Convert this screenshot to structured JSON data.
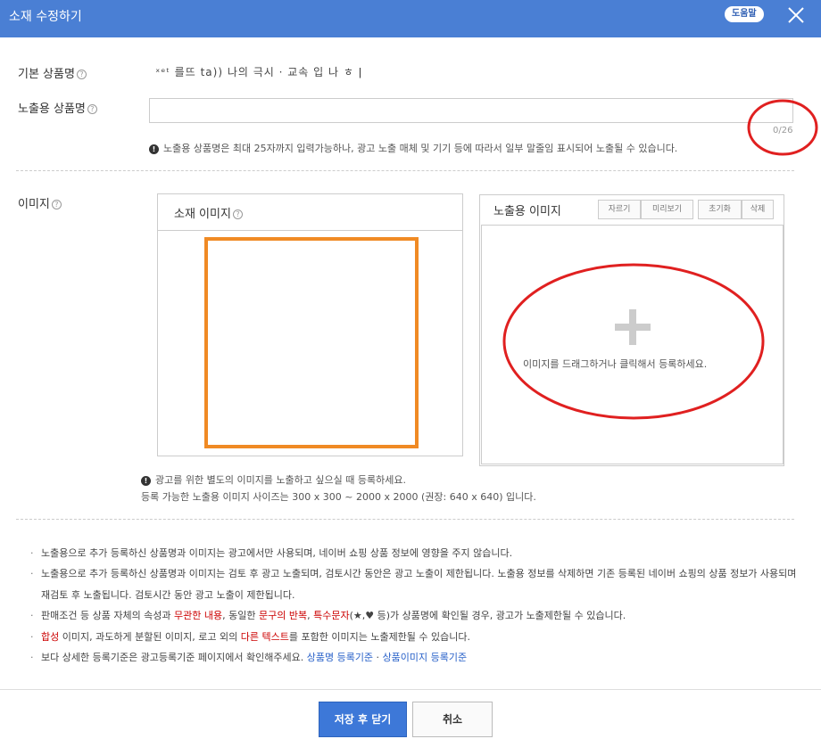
{
  "dialog": {
    "title": "소재 수정하기",
    "help_label": "도움말"
  },
  "form": {
    "basic_name_label": "기본 상품명",
    "basic_name_value": "ˣᵉᵗ 를뜨 ta)) 나의 극시 · 교속 입 나 ㅎ  ǀ",
    "display_name_label": "노출용 상품명",
    "display_name_value": "",
    "display_name_placeholder": "",
    "char_count": "0/26",
    "name_notice": "노출용 상품명은 최대 25자까지 입력가능하나, 광고 노출 매체 및 기기 등에 따라서 일부 말줄임 표시되어 노출될 수 있습니다."
  },
  "image": {
    "section_label": "이미지",
    "source_panel_title": "소재 이미지",
    "display_panel_title": "노출용 이미지",
    "tools": [
      "자르기",
      "미리보기",
      "초기화",
      "삭제"
    ],
    "drop_text": "이미지를 드래그하거나 클릭해서 등록하세요.",
    "notice_line1": "광고를 위한 별도의 이미지를 노출하고 싶으실 때 등록하세요.",
    "notice_line2": "등록 가능한 노출용 이미지 사이즈는 300 x 300 ~ 2000 x 2000 (권장: 640 x 640) 입니다."
  },
  "guidelines": {
    "b1": "노출용으로 추가 등록하신 상품명과 이미지는 광고에서만 사용되며, 네이버 쇼핑 상품 정보에 영향을 주지 않습니다.",
    "b2": "노출용으로 추가 등록하신 상품명과 이미지는 검토 후 광고 노출되며, 검토시간 동안은 광고 노출이 제한됩니다. 노출용 정보를 삭제하면 기존 등록된 네이버 쇼핑의 상품 정보가 사용되며 재검토 후 노출됩니다. 검토시간 동안 광고 노출이 제한됩니다.",
    "b3_p1": "판매조건 등 상품 자체의 속성과 ",
    "b3_r1": "무관한 내용",
    "b3_p2": ", 동일한 ",
    "b3_r2": "문구의 반복",
    "b3_p3": ", ",
    "b3_r3": "특수문자",
    "b3_p4": "(★,♥ 등)가 상품명에 확인될 경우, 광고가 노출제한될 수 있습니다.",
    "b4_r1": "합성",
    "b4_p1": " 이미지, 과도하게 분할된 이미지, 로고 외의 ",
    "b4_r2": "다른 텍스트",
    "b4_p2": "를 포함한 이미지는 노출제한될 수 있습니다.",
    "b5_p1": "보다 상세한 등록기준은 광고등록기준 페이지에서 확인해주세요. ",
    "b5_link1": "상품명 등록기준",
    "b5_sep": " · ",
    "b5_link2": "상품이미지 등록기준"
  },
  "buttons": {
    "save": "저장 후 닫기",
    "cancel": "취소"
  },
  "colors": {
    "header_blue": "#4a7fd4",
    "save_blue": "#3d78d8",
    "highlight_orange": "#f08a24",
    "annotation_red": "#e02020",
    "warning_red": "#cc0000",
    "link_blue": "#2a62c9"
  },
  "icons": {
    "help_question": "question-circle-icon",
    "close": "close-x-icon",
    "warning": "exclamation-circle-icon",
    "add": "plus-icon"
  }
}
